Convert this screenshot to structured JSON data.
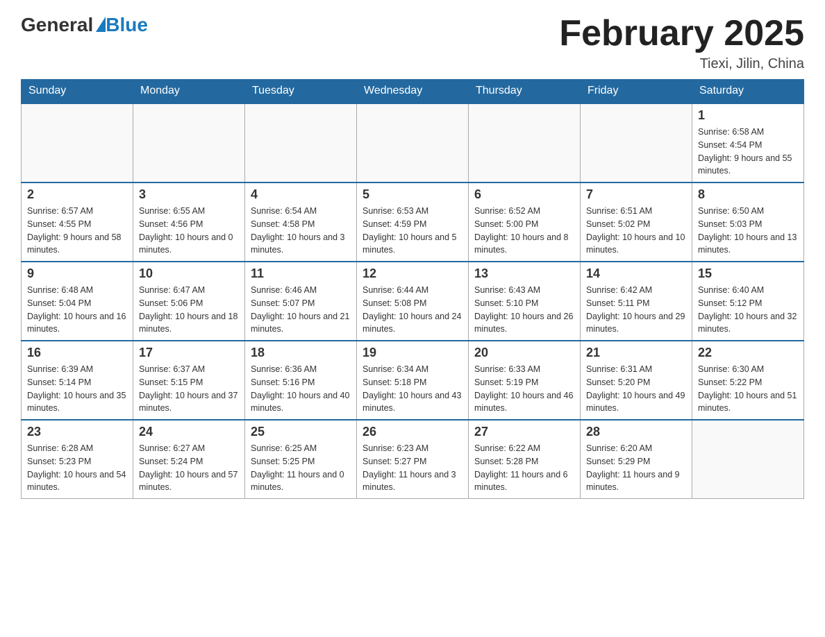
{
  "header": {
    "logo_general": "General",
    "logo_blue": "Blue",
    "month_title": "February 2025",
    "location": "Tiexi, Jilin, China"
  },
  "days_of_week": [
    "Sunday",
    "Monday",
    "Tuesday",
    "Wednesday",
    "Thursday",
    "Friday",
    "Saturday"
  ],
  "weeks": [
    {
      "days": [
        {
          "number": "",
          "info": ""
        },
        {
          "number": "",
          "info": ""
        },
        {
          "number": "",
          "info": ""
        },
        {
          "number": "",
          "info": ""
        },
        {
          "number": "",
          "info": ""
        },
        {
          "number": "",
          "info": ""
        },
        {
          "number": "1",
          "info": "Sunrise: 6:58 AM\nSunset: 4:54 PM\nDaylight: 9 hours and 55 minutes."
        }
      ]
    },
    {
      "days": [
        {
          "number": "2",
          "info": "Sunrise: 6:57 AM\nSunset: 4:55 PM\nDaylight: 9 hours and 58 minutes."
        },
        {
          "number": "3",
          "info": "Sunrise: 6:55 AM\nSunset: 4:56 PM\nDaylight: 10 hours and 0 minutes."
        },
        {
          "number": "4",
          "info": "Sunrise: 6:54 AM\nSunset: 4:58 PM\nDaylight: 10 hours and 3 minutes."
        },
        {
          "number": "5",
          "info": "Sunrise: 6:53 AM\nSunset: 4:59 PM\nDaylight: 10 hours and 5 minutes."
        },
        {
          "number": "6",
          "info": "Sunrise: 6:52 AM\nSunset: 5:00 PM\nDaylight: 10 hours and 8 minutes."
        },
        {
          "number": "7",
          "info": "Sunrise: 6:51 AM\nSunset: 5:02 PM\nDaylight: 10 hours and 10 minutes."
        },
        {
          "number": "8",
          "info": "Sunrise: 6:50 AM\nSunset: 5:03 PM\nDaylight: 10 hours and 13 minutes."
        }
      ]
    },
    {
      "days": [
        {
          "number": "9",
          "info": "Sunrise: 6:48 AM\nSunset: 5:04 PM\nDaylight: 10 hours and 16 minutes."
        },
        {
          "number": "10",
          "info": "Sunrise: 6:47 AM\nSunset: 5:06 PM\nDaylight: 10 hours and 18 minutes."
        },
        {
          "number": "11",
          "info": "Sunrise: 6:46 AM\nSunset: 5:07 PM\nDaylight: 10 hours and 21 minutes."
        },
        {
          "number": "12",
          "info": "Sunrise: 6:44 AM\nSunset: 5:08 PM\nDaylight: 10 hours and 24 minutes."
        },
        {
          "number": "13",
          "info": "Sunrise: 6:43 AM\nSunset: 5:10 PM\nDaylight: 10 hours and 26 minutes."
        },
        {
          "number": "14",
          "info": "Sunrise: 6:42 AM\nSunset: 5:11 PM\nDaylight: 10 hours and 29 minutes."
        },
        {
          "number": "15",
          "info": "Sunrise: 6:40 AM\nSunset: 5:12 PM\nDaylight: 10 hours and 32 minutes."
        }
      ]
    },
    {
      "days": [
        {
          "number": "16",
          "info": "Sunrise: 6:39 AM\nSunset: 5:14 PM\nDaylight: 10 hours and 35 minutes."
        },
        {
          "number": "17",
          "info": "Sunrise: 6:37 AM\nSunset: 5:15 PM\nDaylight: 10 hours and 37 minutes."
        },
        {
          "number": "18",
          "info": "Sunrise: 6:36 AM\nSunset: 5:16 PM\nDaylight: 10 hours and 40 minutes."
        },
        {
          "number": "19",
          "info": "Sunrise: 6:34 AM\nSunset: 5:18 PM\nDaylight: 10 hours and 43 minutes."
        },
        {
          "number": "20",
          "info": "Sunrise: 6:33 AM\nSunset: 5:19 PM\nDaylight: 10 hours and 46 minutes."
        },
        {
          "number": "21",
          "info": "Sunrise: 6:31 AM\nSunset: 5:20 PM\nDaylight: 10 hours and 49 minutes."
        },
        {
          "number": "22",
          "info": "Sunrise: 6:30 AM\nSunset: 5:22 PM\nDaylight: 10 hours and 51 minutes."
        }
      ]
    },
    {
      "days": [
        {
          "number": "23",
          "info": "Sunrise: 6:28 AM\nSunset: 5:23 PM\nDaylight: 10 hours and 54 minutes."
        },
        {
          "number": "24",
          "info": "Sunrise: 6:27 AM\nSunset: 5:24 PM\nDaylight: 10 hours and 57 minutes."
        },
        {
          "number": "25",
          "info": "Sunrise: 6:25 AM\nSunset: 5:25 PM\nDaylight: 11 hours and 0 minutes."
        },
        {
          "number": "26",
          "info": "Sunrise: 6:23 AM\nSunset: 5:27 PM\nDaylight: 11 hours and 3 minutes."
        },
        {
          "number": "27",
          "info": "Sunrise: 6:22 AM\nSunset: 5:28 PM\nDaylight: 11 hours and 6 minutes."
        },
        {
          "number": "28",
          "info": "Sunrise: 6:20 AM\nSunset: 5:29 PM\nDaylight: 11 hours and 9 minutes."
        },
        {
          "number": "",
          "info": ""
        }
      ]
    }
  ]
}
